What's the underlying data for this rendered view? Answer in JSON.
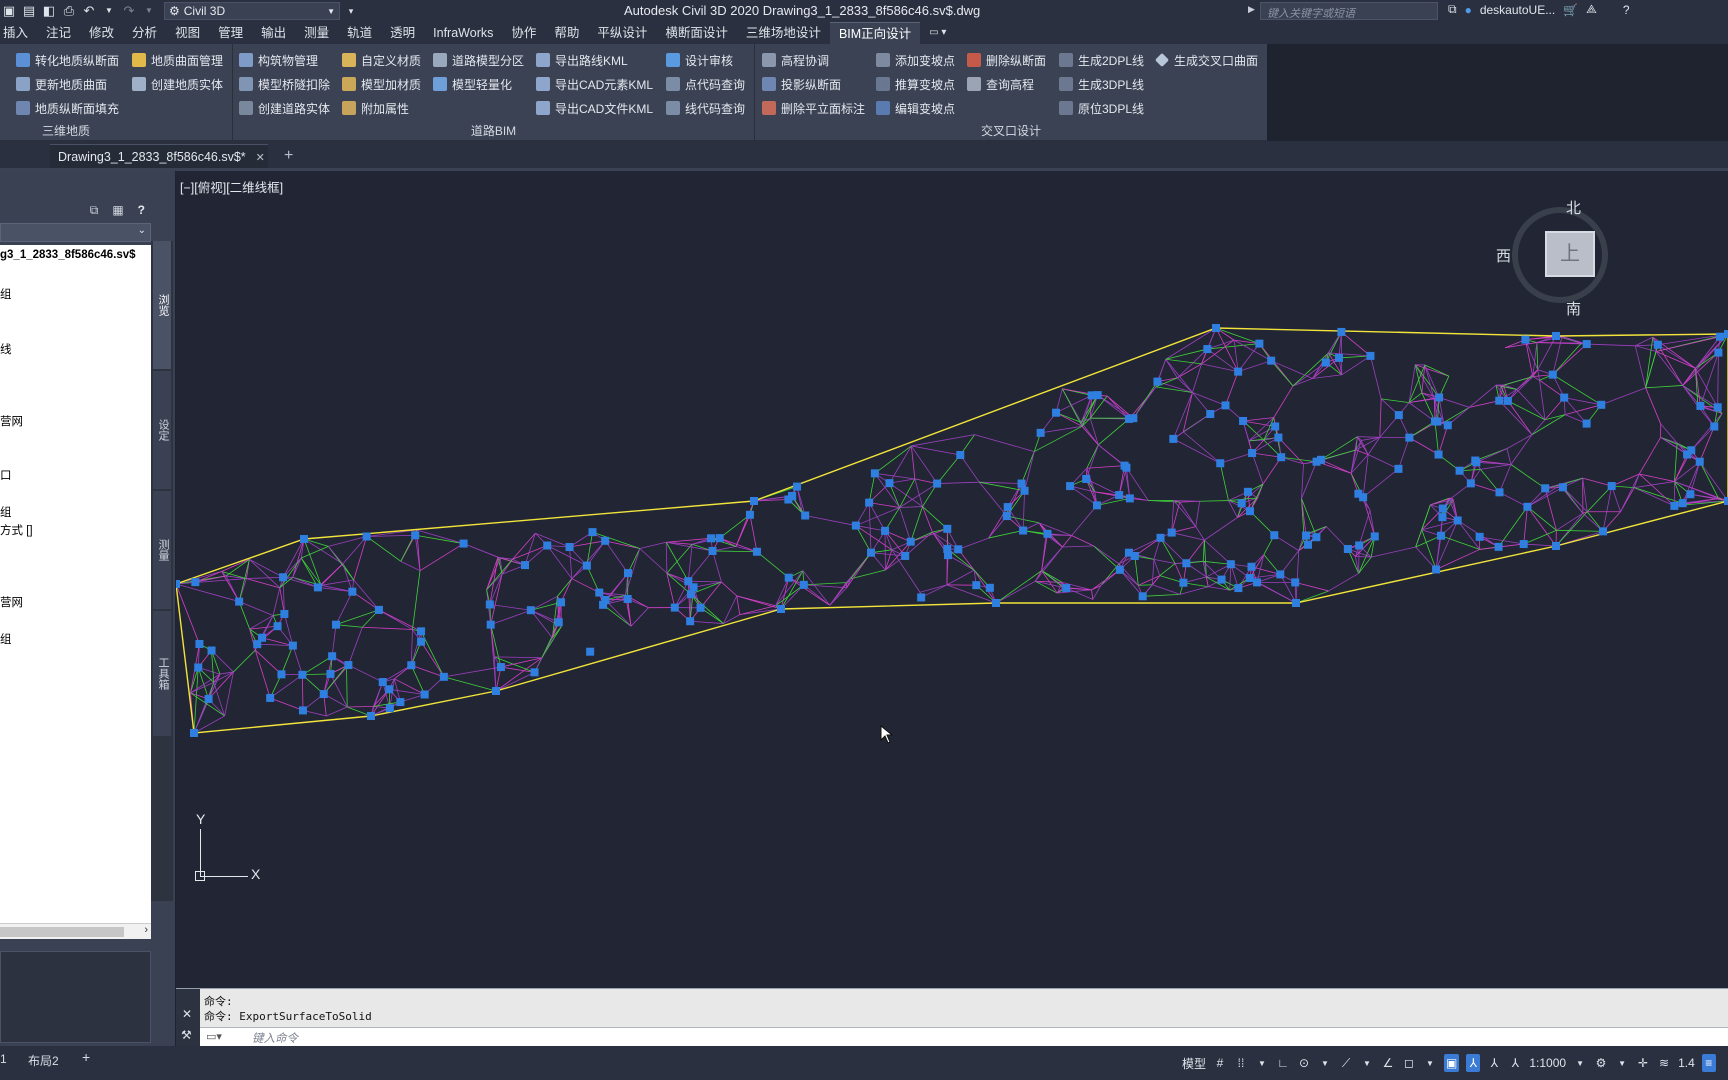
{
  "app": {
    "workspace": "Civil 3D",
    "title": "Autodesk Civil 3D 2020    Drawing3_1_2833_8f586c46.sv$.dwg",
    "search_placeholder": "键入关键字或短语",
    "user": "deskautoUE..."
  },
  "menu": [
    "插入",
    "注记",
    "修改",
    "分析",
    "视图",
    "管理",
    "输出",
    "测量",
    "轨道",
    "透明",
    "InfraWorks",
    "协作",
    "帮助",
    "平纵设计",
    "横断面设计",
    "三维场地设计",
    "BIM正向设计"
  ],
  "ribbon": {
    "panel1": {
      "title": "三维地质",
      "buttons": [
        "转化地质纵断面",
        "地质曲面管理",
        "更新地质曲面",
        "创建地质实体",
        "地质纵断面填充"
      ]
    },
    "panel2": {
      "title": "道路BIM",
      "buttons": [
        "构筑物管理",
        "自定义材质",
        "道路模型分区",
        "导出路线KML",
        "设计审核",
        "模型桥隧扣除",
        "模型加材质",
        "模型轻量化",
        "导出CAD元素KML",
        "点代码查询",
        "创建道路实体",
        "附加属性",
        "导出CAD文件KML",
        "线代码查询"
      ]
    },
    "panel3": {
      "title": "交叉口设计",
      "buttons": [
        "高程协调",
        "添加变坡点",
        "删除纵断面",
        "生成2DPL线",
        "生成交叉口曲面",
        "投影纵断面",
        "推算变坡点",
        "查询高程",
        "生成3DPL线",
        "删除平立面标注",
        "编辑变坡点",
        "原位3DPL线"
      ]
    }
  },
  "doc_tab": {
    "label": "Drawing3_1_2833_8f586c46.sv$*",
    "close": "✕",
    "new": "+"
  },
  "palette": {
    "tree": [
      "g3_1_2833_8f586c46.sv$",
      "组",
      "线",
      "营网",
      "口",
      "组",
      "方式 []",
      "营网",
      "组"
    ],
    "vtabs": [
      "浏览",
      "设定",
      "测量",
      "工具箱"
    ]
  },
  "viewport": {
    "label": "[−][俯视][二维线框]",
    "viewcube": {
      "north": "北",
      "west": "西",
      "south": "南",
      "top": "上"
    },
    "ucs": {
      "x": "X",
      "y": "Y"
    }
  },
  "command": {
    "history": [
      "命令:",
      "命令: ExportSurfaceToSolid"
    ],
    "placeholder": "键入命令"
  },
  "layout_tabs": [
    "1",
    "布局2",
    "+"
  ],
  "status": {
    "model": "模型",
    "scale": "1:1000",
    "zoom": "1.4"
  },
  "colors": {
    "accent": "#3a7bd5",
    "tin_vertex": "#2f7fe0",
    "tin_edge_purple": "#9b3fbf",
    "tin_edge_green": "#3fd13a",
    "tin_boundary": "#f2e43a",
    "tin_magenta": "#d43fc8"
  }
}
